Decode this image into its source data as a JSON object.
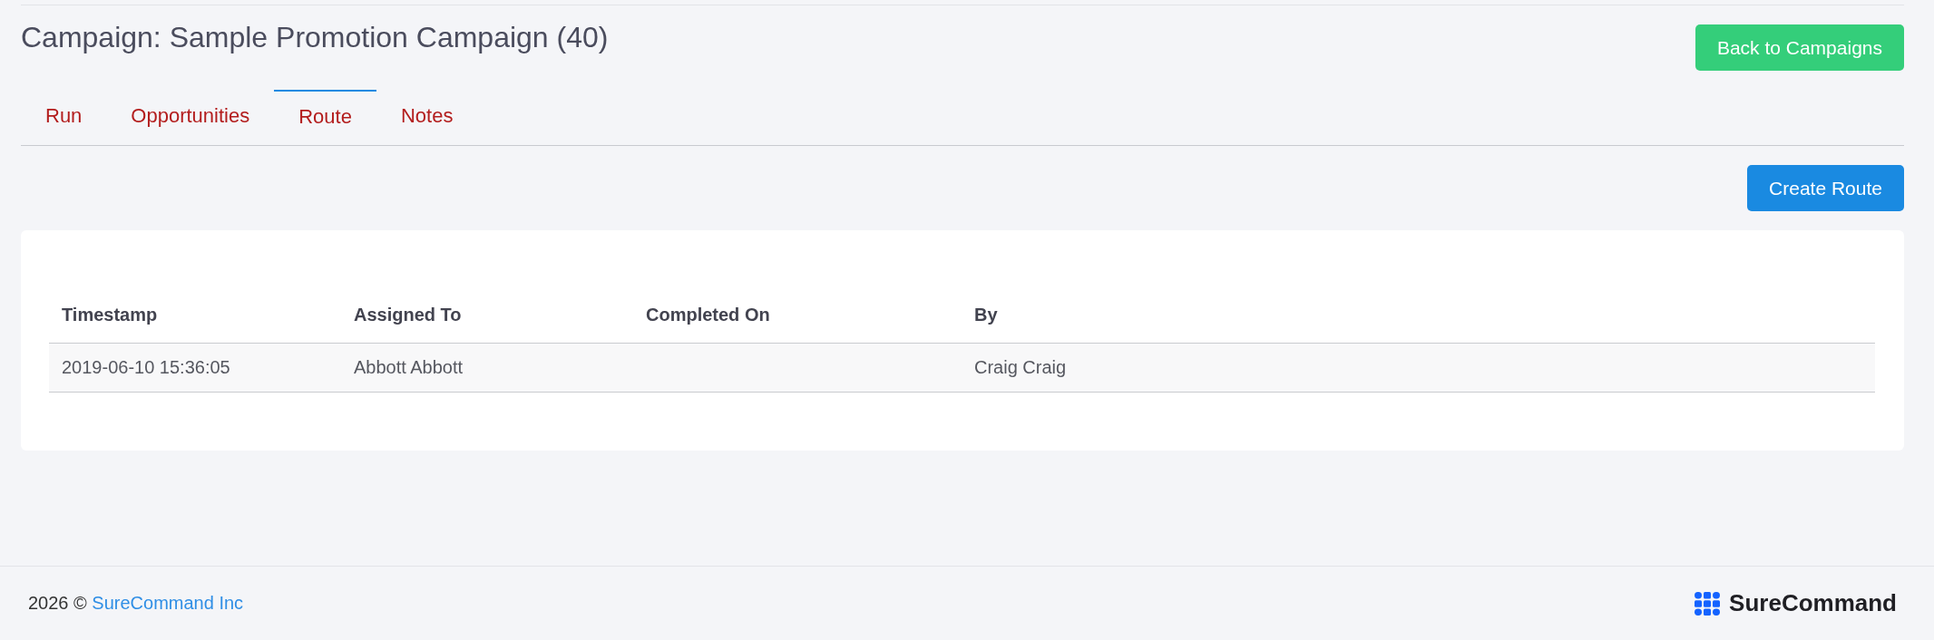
{
  "page": {
    "title": "Campaign: Sample Promotion Campaign (40)",
    "back_button": "Back to Campaigns"
  },
  "tabs": [
    {
      "label": "Run",
      "selected": false
    },
    {
      "label": "Opportunities",
      "selected": false
    },
    {
      "label": "Route",
      "selected": true
    },
    {
      "label": "Notes",
      "selected": false
    }
  ],
  "actions": {
    "create_button": "Create Route"
  },
  "table": {
    "columns": [
      "Timestamp",
      "Assigned To",
      "Completed On",
      "By"
    ],
    "rows": [
      {
        "cells": [
          "2019-06-10 15:36:05",
          "Abbott Abbott",
          null,
          "Craig Craig"
        ]
      }
    ]
  },
  "footer": {
    "copyright": "2026 ©",
    "company_link": "SureCommand Inc",
    "brand": "SureCommand"
  }
}
